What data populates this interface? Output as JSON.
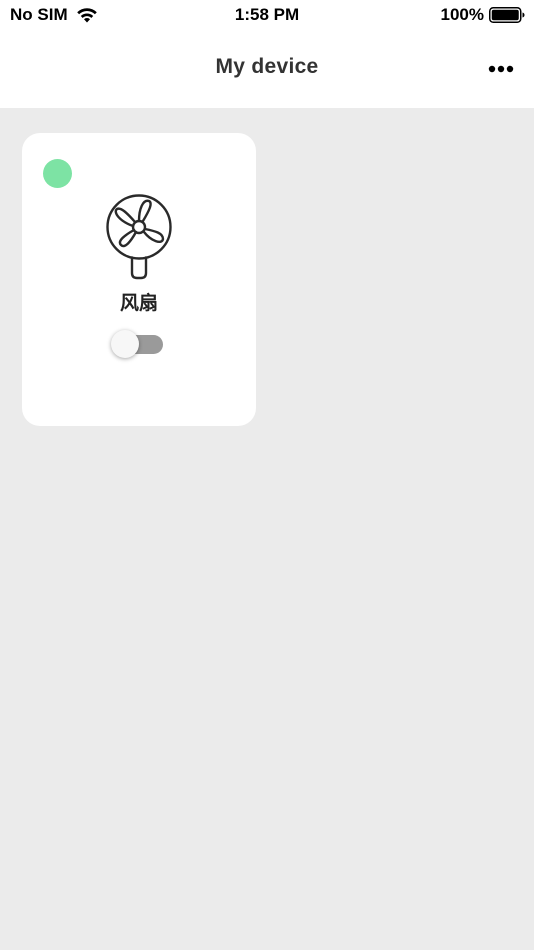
{
  "status_bar": {
    "carrier": "No SIM",
    "time": "1:58 PM",
    "battery": "100%",
    "icons": [
      "wifi-icon",
      "battery-icon"
    ]
  },
  "nav": {
    "title": "My device",
    "more_icon": "ellipsis-icon"
  },
  "devices": [
    {
      "name": "风扇",
      "icon": "fan-icon",
      "online": true,
      "status_color": "#7de3a4",
      "switch_on": false
    }
  ],
  "colors": {
    "background": "#ebebeb",
    "card": "#ffffff",
    "toggle_track_off": "#9a9a9a"
  }
}
